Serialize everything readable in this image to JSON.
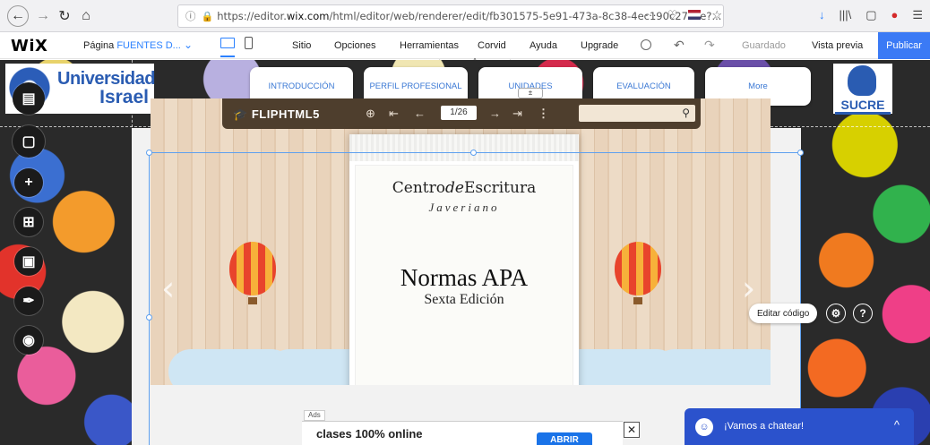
{
  "browser": {
    "back_icon": "arrow-left-icon",
    "forward_icon": "arrow-right-icon",
    "reload_icon": "reload-icon",
    "home_icon": "home-icon",
    "url_prefix": "https://editor.",
    "url_domain": "wix.com",
    "url_path": "/html/editor/web/renderer/edit/fb301575-5e91-473a-8c38-4ec190c27ace?...",
    "more": "···",
    "pocket": "♡",
    "star": "☆",
    "tools": [
      "↓",
      "|||\\",
      "▢",
      "●",
      "☰"
    ]
  },
  "wix": {
    "logo": "WiX",
    "page_label": "Página",
    "page_name": "FUENTES D...",
    "menu": [
      "Sitio",
      "Opciones",
      "Herramientas",
      "Corvid",
      "Ayuda",
      "Upgrade"
    ],
    "undo": "↶",
    "redo": "↷",
    "saved": "Guardado",
    "preview": "Vista previa",
    "publish": "Publicar"
  },
  "site": {
    "logo_line1": "Universidad",
    "logo_line2": "Israel",
    "nav": [
      "INTRODUCCIÓN",
      "PERFIL PROFESIONAL",
      "UNIDADES",
      "EVALUACIÓN",
      "More"
    ],
    "sucre": "SUCRE"
  },
  "flipbook": {
    "brand": "FLIPHTML5",
    "page_indicator": "1/26",
    "zoom_icon": "zoom-in-icon",
    "search_icon": "search-icon",
    "doc": {
      "title_a": "Centro",
      "title_b": "de",
      "title_c": "Escritura",
      "subtitle": "Javeriano",
      "heading": "Normas APA",
      "edition": "Sexta Edición"
    }
  },
  "editor_tools": {
    "edit_code": "Editar código",
    "settings_icon": "gear-icon",
    "help_icon": "help-icon"
  },
  "ad": {
    "tag": "Ads",
    "text": "clases 100% online",
    "button": "ABRIR",
    "close": "✕"
  },
  "chat": {
    "label": "¡Vamos a chatear!",
    "chevron": "^"
  }
}
